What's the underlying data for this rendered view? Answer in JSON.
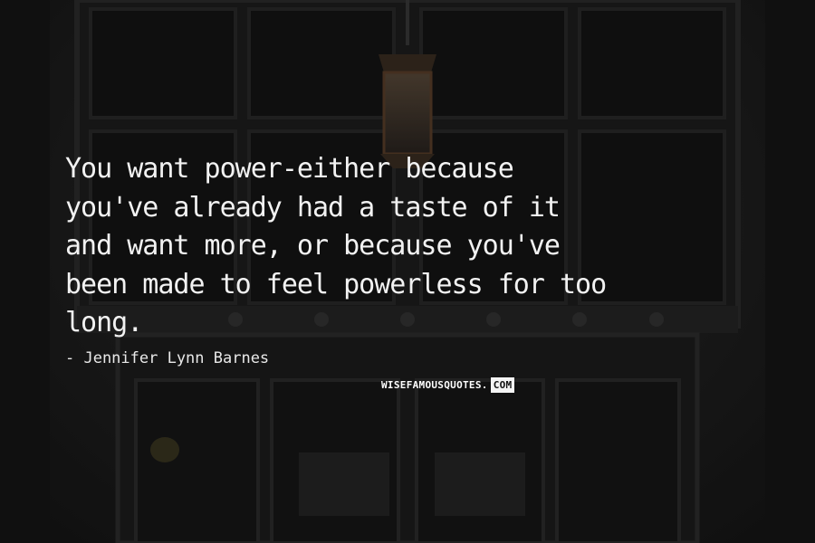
{
  "quote": {
    "lines": [
      "You want power-either because",
      "you've already had a taste of it",
      "and want more, or because you've",
      "been made to feel powerless for too",
      "long."
    ]
  },
  "author": "- Jennifer Lynn Barnes",
  "watermark": {
    "text": "WISEFAMOUSQUOTES.",
    "suffix": "COM"
  },
  "colors": {
    "text": "#f2f2f2",
    "background": "#1b1b1b"
  }
}
